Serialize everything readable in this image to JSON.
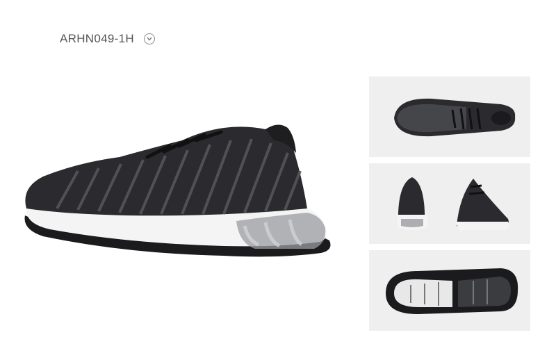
{
  "product": {
    "sku": "ARHN049-1H"
  },
  "icons": {
    "sku_toggle": "chevron-down-circle-icon"
  },
  "colors": {
    "upper": "#2b2b2f",
    "upper_knit": "#55565a",
    "midsole": "#f4f4f4",
    "air_unit": "#9a9ca0",
    "outsole": "#1b1b1d",
    "thumb_bg": "#efefef"
  },
  "gallery": {
    "views": [
      "top-view",
      "back-and-front-view",
      "sole-view"
    ]
  }
}
